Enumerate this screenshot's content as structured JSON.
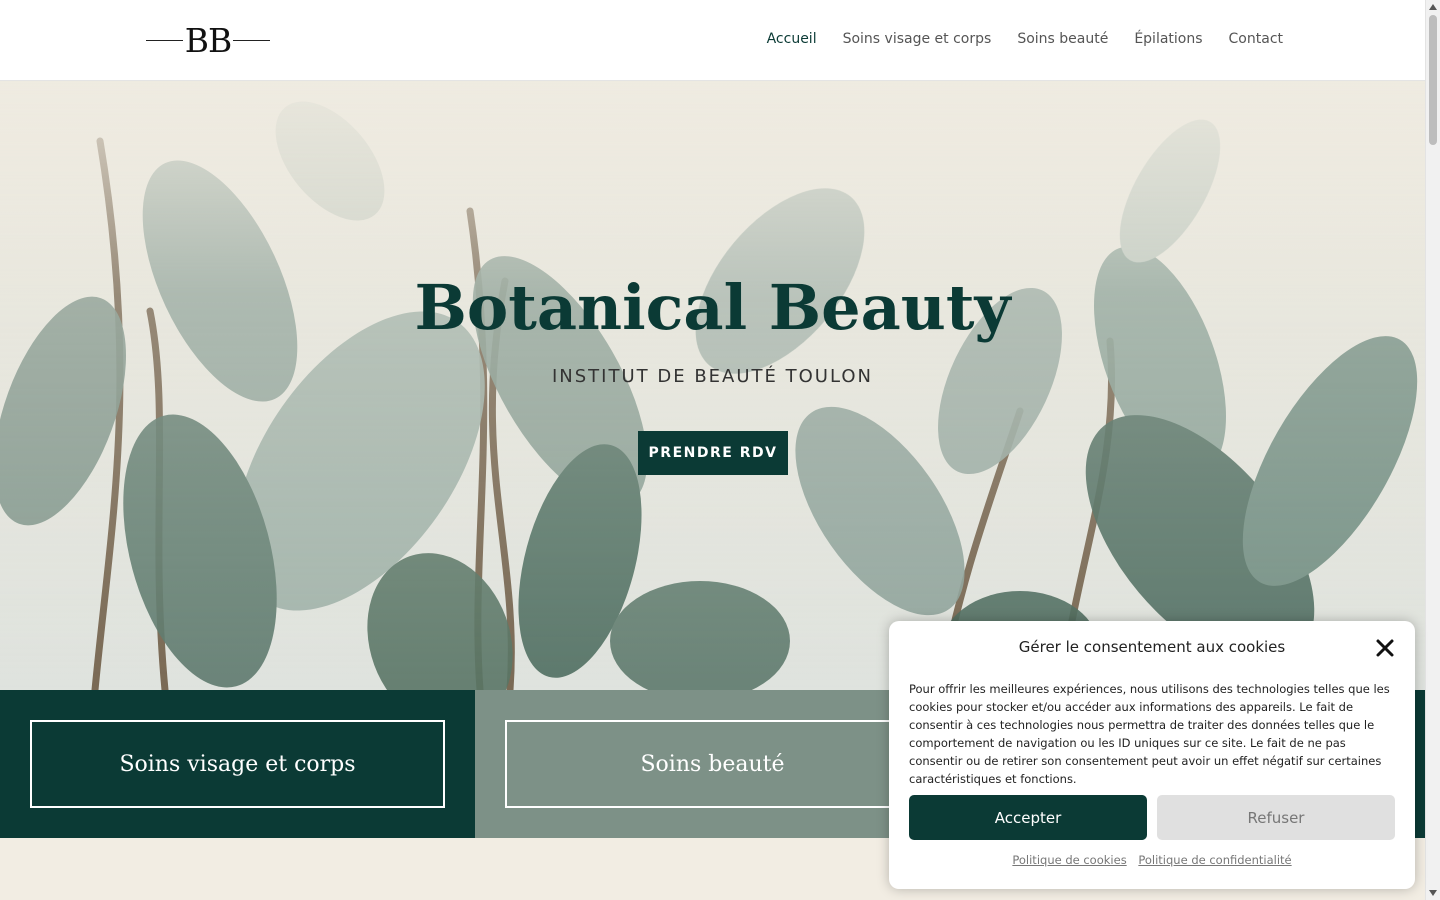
{
  "header": {
    "logo_text": "BB",
    "nav": [
      "Accueil",
      "Soins visage et corps",
      "Soins beauté",
      "Épilations",
      "Contact"
    ]
  },
  "hero": {
    "title": "Botanical Beauty",
    "subtitle": "INSTITUT DE BEAUTÉ TOULON",
    "button": "PRENDRE RDV"
  },
  "cards": [
    {
      "label": "Soins visage et corps",
      "color": "#0b3a35"
    },
    {
      "label": "Soins beauté",
      "color": "#7d9187"
    },
    {
      "label": "",
      "color": "#0b3a35"
    }
  ],
  "cookie": {
    "title": "Gérer le consentement aux cookies",
    "text": "Pour offrir les meilleures expériences, nous utilisons des technologies telles que les cookies pour stocker et/ou accéder aux informations des appareils. Le fait de consentir à ces technologies nous permettra de traiter des données telles que le comportement de navigation ou les ID uniques sur ce site. Le fait de ne pas consentir ou de retirer son consentement peut avoir un effet négatif sur certaines caractéristiques et fonctions.",
    "accept": "Accepter",
    "refuse": "Refuser",
    "links": [
      "Politique de cookies",
      "Politique de confidentialité"
    ]
  },
  "colors": {
    "brand": "#0b3a35",
    "sage": "#7d9187"
  }
}
